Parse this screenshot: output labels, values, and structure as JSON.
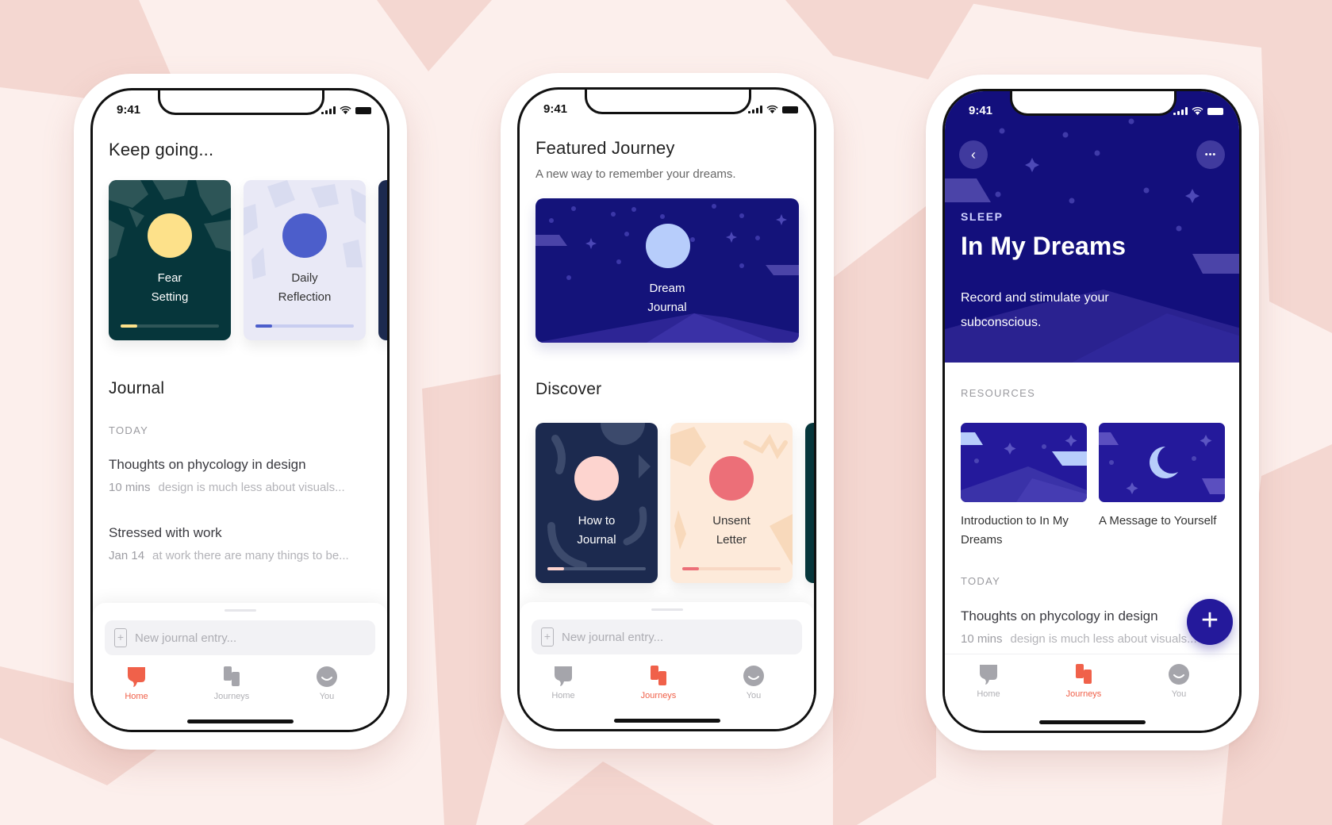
{
  "colors": {
    "background": "#fcefec",
    "background_shape": "#f4d7d1",
    "accent_coral": "#f0614a",
    "navy": "#130f7c",
    "indigo": "#24199b",
    "tab_inactive": "#a5a5ab"
  },
  "status_bar": {
    "time": "9:41"
  },
  "tabbar": {
    "tabs": [
      {
        "id": "home",
        "label": "Home",
        "icon": "speech-bubble-icon"
      },
      {
        "id": "journeys",
        "label": "Journeys",
        "icon": "cards-icon"
      },
      {
        "id": "you",
        "label": "You",
        "icon": "smiley-icon"
      }
    ]
  },
  "new_entry": {
    "placeholder": "New journal entry..."
  },
  "home_screen": {
    "active_tab": "Home",
    "keep_going_title": "Keep going...",
    "journeys": [
      {
        "line1": "Fear",
        "line2": "Setting",
        "progress": 0.17,
        "bg": "#06363b",
        "circle": "#fde18a",
        "bar": "#2f5658",
        "fill": "#fde18a",
        "text": "#ffffff"
      },
      {
        "line1": "Daily",
        "line2": "Reflection",
        "progress": 0.17,
        "bg": "#e9e9f6",
        "circle": "#4c5ecb",
        "bar": "#c8cdf0",
        "fill": "#4c5ecb",
        "text": "#333333"
      }
    ],
    "journal_title": "Journal",
    "section_label": "TODAY",
    "entries": [
      {
        "title": "Thoughts on phycology in design",
        "meta": "10 mins",
        "preview": "design is much less about visuals..."
      },
      {
        "title": "Stressed with work",
        "meta": "Jan 14",
        "preview": "at work there are many things to be..."
      }
    ]
  },
  "journeys_screen": {
    "active_tab": "Journeys",
    "featured_title": "Featured Journey",
    "featured_subtitle": "A new way to remember your dreams.",
    "featured_card": {
      "line1": "Dream",
      "line2": "Journal"
    },
    "discover_title": "Discover",
    "discover_cards": [
      {
        "line1": "How to",
        "line2": "Journal",
        "progress": 0.17,
        "bg": "#1c2a4f",
        "circle": "#fdd4cf",
        "bar": "#4a5878",
        "fill": "#fdd4cf",
        "text": "#ffffff"
      },
      {
        "line1": "Unsent",
        "line2": "Letter",
        "progress": 0.17,
        "bg": "#fdeada",
        "circle": "#ec6f78",
        "bar": "#f8d8c4",
        "fill": "#ec6f78",
        "text": "#333333"
      }
    ]
  },
  "detail_screen": {
    "active_tab": "Journeys",
    "category": "SLEEP",
    "title": "In My Dreams",
    "description": "Record and stimulate your subconscious.",
    "back_label": "‹",
    "more_label": "•••",
    "resources_label": "RESOURCES",
    "resources": [
      {
        "title": "Introduction to In My Dreams"
      },
      {
        "title": "A Message to Yourself"
      }
    ],
    "section_label": "TODAY",
    "entry": {
      "title": "Thoughts on phycology in design",
      "meta": "10 mins",
      "preview": "design is much less about visuals..."
    },
    "fab_label": "+"
  }
}
